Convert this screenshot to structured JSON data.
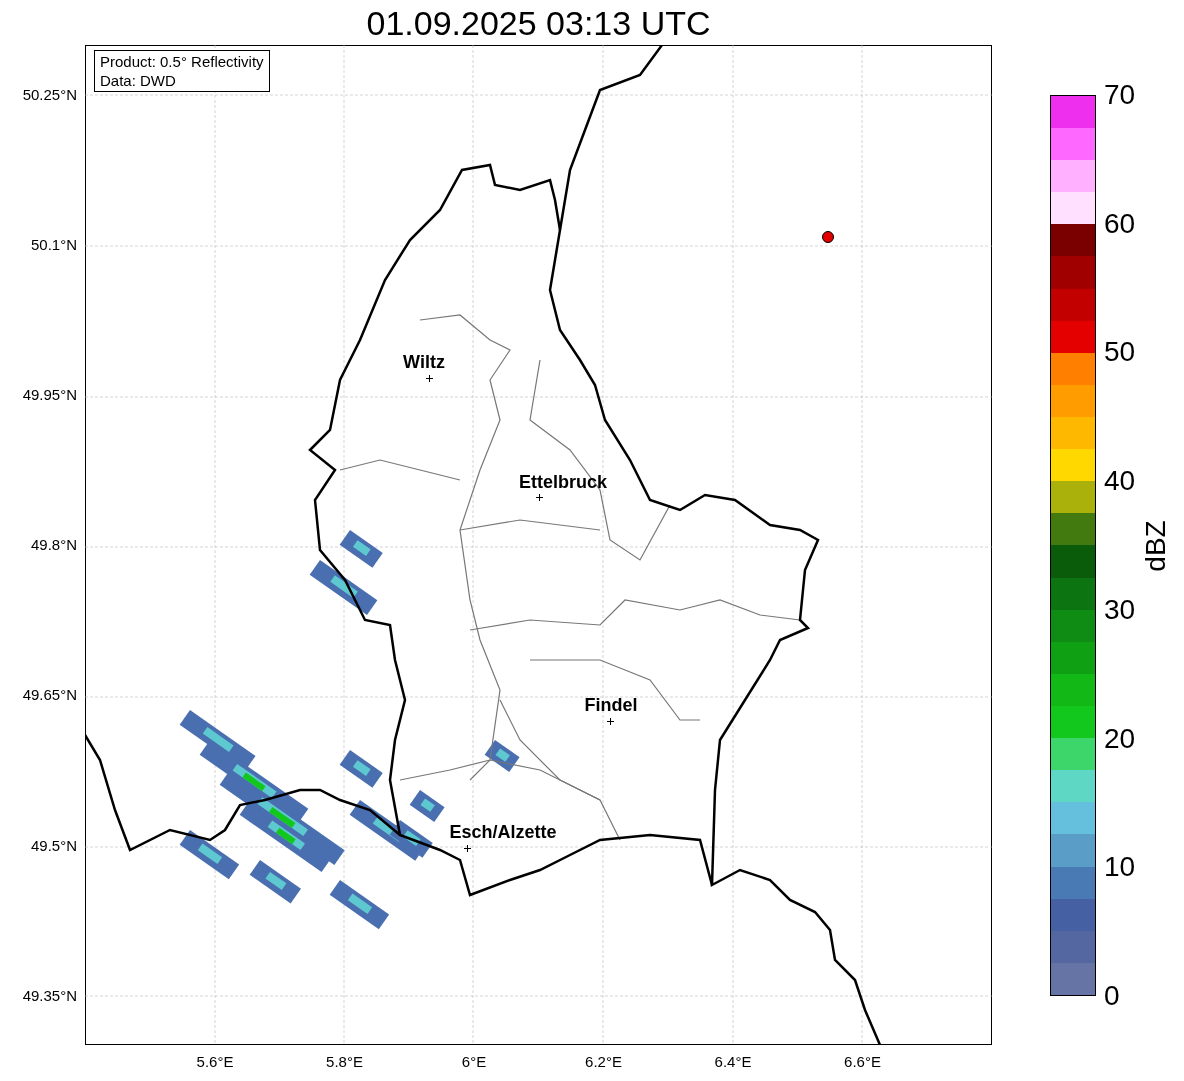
{
  "title": "01.09.2025 03:13 UTC",
  "info_box": [
    "Product: 0.5° Reflectivity",
    "Data: DWD"
  ],
  "y_ticks": [
    "50.25°N",
    "50.1°N",
    "49.95°N",
    "49.8°N",
    "49.65°N",
    "49.5°N",
    "49.35°N"
  ],
  "x_ticks": [
    "5.6°E",
    "5.8°E",
    "6°E",
    "6.2°E",
    "6.4°E",
    "6.6°E"
  ],
  "cities": [
    {
      "name": "Wiltz"
    },
    {
      "name": "Ettelbruck"
    },
    {
      "name": "Findel"
    },
    {
      "name": "Esch/Alzette"
    }
  ],
  "colorbar": {
    "label": "dBZ",
    "ticks": [
      "70",
      "60",
      "50",
      "40",
      "30",
      "20",
      "10",
      "0"
    ],
    "bands": [
      {
        "color": "#6673a5"
      },
      {
        "color": "#5467a0"
      },
      {
        "color": "#4560a3"
      },
      {
        "color": "#4a7ab4"
      },
      {
        "color": "#5a9ec8"
      },
      {
        "color": "#64c0dc"
      },
      {
        "color": "#5ed8c4"
      },
      {
        "color": "#3dd66a"
      },
      {
        "color": "#12c81c"
      },
      {
        "color": "#12b816"
      },
      {
        "color": "#10a013"
      },
      {
        "color": "#0f8c13"
      },
      {
        "color": "#0c7410"
      },
      {
        "color": "#0a5c0a"
      },
      {
        "color": "#437a10"
      },
      {
        "color": "#aab10b"
      },
      {
        "color": "#ffd800"
      },
      {
        "color": "#ffb800"
      },
      {
        "color": "#ff9c00"
      },
      {
        "color": "#ff7f00"
      },
      {
        "color": "#e50000"
      },
      {
        "color": "#c20000"
      },
      {
        "color": "#a00000"
      },
      {
        "color": "#7a0000"
      },
      {
        "color": "#ffe0ff"
      },
      {
        "color": "#ffb0ff"
      },
      {
        "color": "#ff68ff"
      },
      {
        "color": "#ee30ee"
      }
    ]
  }
}
